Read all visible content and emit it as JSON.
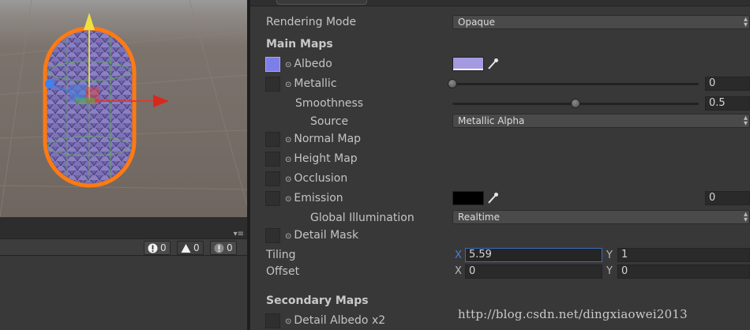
{
  "console": {
    "errors": "0",
    "warnings": "0",
    "messages": "0"
  },
  "inspector": {
    "rendering_mode": {
      "label": "Rendering Mode",
      "value": "Opaque"
    },
    "main_maps": {
      "header": "Main Maps",
      "albedo": {
        "label": "Albedo",
        "color": "#a39ae0"
      },
      "metallic": {
        "label": "Metallic",
        "value": "0",
        "fraction": 0.0
      },
      "smoothness": {
        "label": "Smoothness",
        "value": "0.5",
        "fraction": 0.5
      },
      "source": {
        "label": "Source",
        "value": "Metallic Alpha"
      },
      "normal_map": {
        "label": "Normal Map"
      },
      "height_map": {
        "label": "Height Map"
      },
      "occlusion": {
        "label": "Occlusion"
      },
      "emission": {
        "label": "Emission",
        "color": "#000000",
        "value": "0"
      },
      "global_illumination": {
        "label": "Global Illumination",
        "value": "Realtime"
      },
      "detail_mask": {
        "label": "Detail Mask"
      },
      "tiling": {
        "label": "Tiling",
        "x_label": "X",
        "x": "5.59",
        "y_label": "Y",
        "y": "1"
      },
      "offset": {
        "label": "Offset",
        "x_label": "X",
        "x": "0",
        "y_label": "Y",
        "y": "0"
      }
    },
    "secondary_maps": {
      "header": "Secondary Maps",
      "detail_albedo": {
        "label": "Detail Albedo x2"
      }
    }
  },
  "watermark": "http://blog.csdn.net/dingxiaowei2013",
  "colors": {
    "selection_outline": "#ff7a14",
    "albedo_texture": "#7d7ee8",
    "field_focus": "#3a6bc0"
  }
}
